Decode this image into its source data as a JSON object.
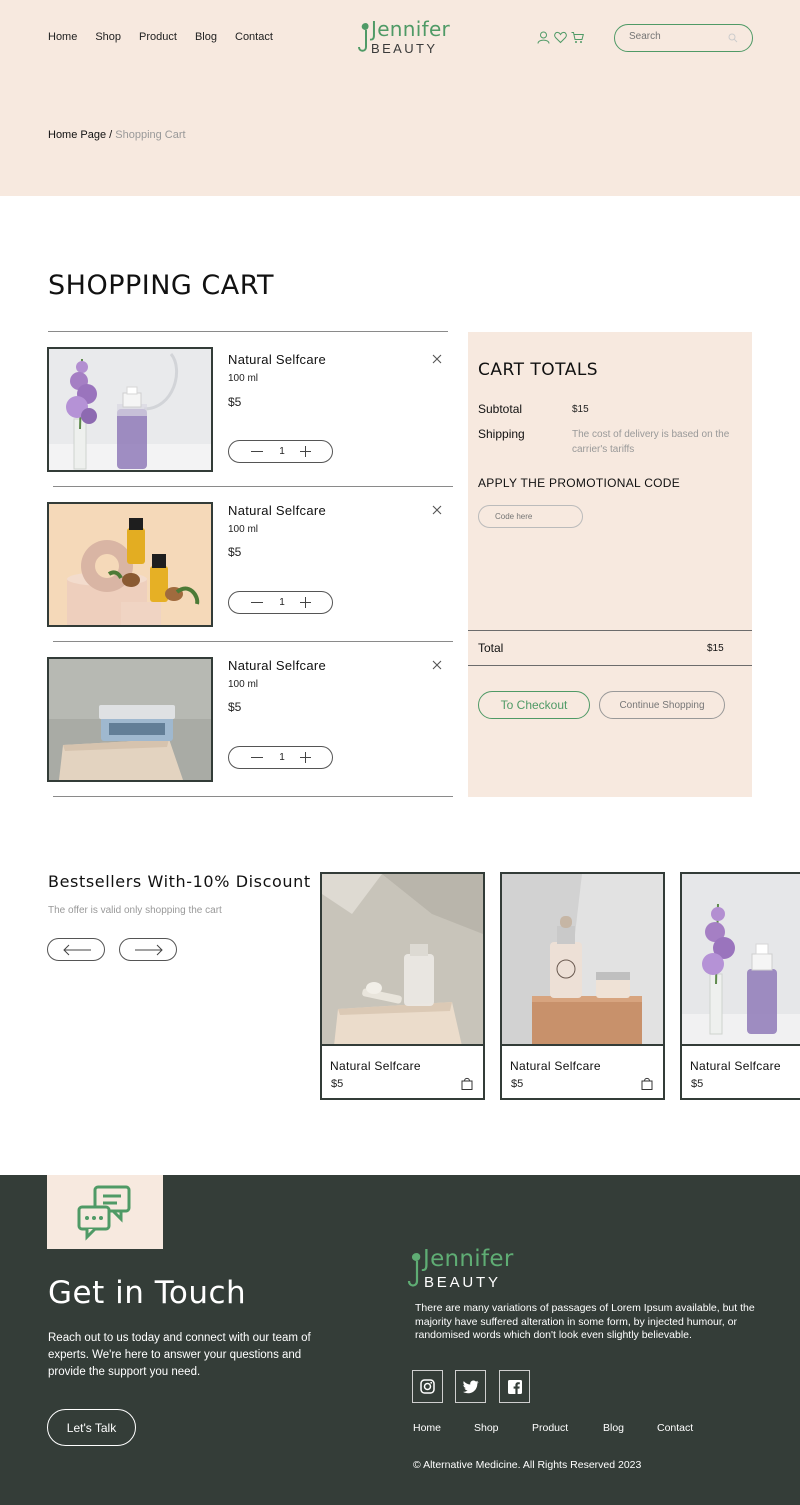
{
  "header": {
    "nav": [
      "Home",
      "Shop",
      "Product",
      "Blog",
      "Contact"
    ],
    "logo_script": "Jennifer",
    "logo_word": "BEAUTY",
    "search_placeholder": "Search",
    "icons": [
      "user-icon",
      "heart-icon",
      "cart-icon",
      "search-icon"
    ]
  },
  "breadcrumb": {
    "home": "Home Page /",
    "current": " Shopping Cart"
  },
  "cart": {
    "title": "SHOPPING CART",
    "items": [
      {
        "name": "Natural Selfcare",
        "volume": "100 ml",
        "price": "$5",
        "qty": "1"
      },
      {
        "name": "Natural Selfcare",
        "volume": "100 ml",
        "price": "$5",
        "qty": "1"
      },
      {
        "name": "Natural Selfcare",
        "volume": "100 ml",
        "price": "$5",
        "qty": "1"
      }
    ]
  },
  "totals": {
    "title": "CART TOTALS",
    "subtotal_label": "Subtotal",
    "subtotal_value": "$15",
    "shipping_label": "Shipping",
    "shipping_note": "The cost of delivery is based on the carrier's tariffs",
    "promo_title": "APPLY THE PROMOTIONAL CODE",
    "promo_placeholder": "Code here",
    "total_label": "Total",
    "total_value": "$15",
    "checkout_label": "To Checkout",
    "continue_label": "Continue Shopping"
  },
  "bestsellers": {
    "title": "Bestsellers With-10% Discount",
    "subtitle": "The offer is valid only shopping the cart",
    "products": [
      {
        "name": "Natural Selfcare",
        "price": "$5"
      },
      {
        "name": "Natural Selfcare",
        "price": "$5"
      },
      {
        "name": "Natural Selfcare",
        "price": "$5"
      }
    ]
  },
  "footer": {
    "title": "Get in Touch",
    "text": "Reach out to us today and connect with our team of experts. We're here to answer your questions and provide the support you need.",
    "button": "Let's Talk",
    "logo_script": "Jennifer",
    "logo_word": "BEAUTY",
    "description": "There are many variations of passages of Lorem Ipsum available, but the majority have suffered alteration in some form, by injected humour, or randomised words which don't look even slightly believable.",
    "social": [
      "instagram-icon",
      "twitter-icon",
      "facebook-icon"
    ],
    "nav": [
      "Home",
      "Shop",
      "Product",
      "Blog",
      "Contact"
    ],
    "copyright": "© Alternative Medicine. All Rights Reserved 2023"
  },
  "colors": {
    "accent": "#4f9a66",
    "cream": "#f7e9df",
    "dark": "#343d38"
  }
}
